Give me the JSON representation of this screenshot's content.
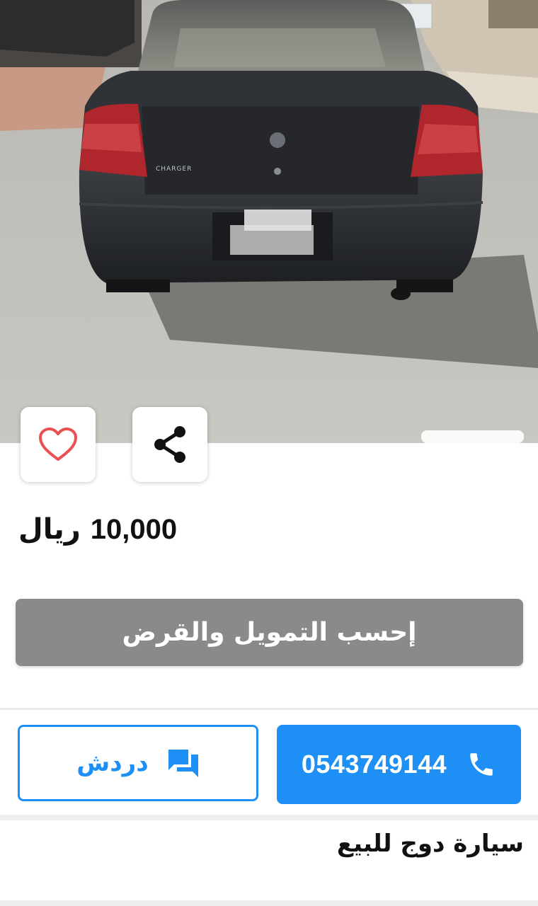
{
  "listing": {
    "price_amount": "10,000",
    "price_currency": "ريال",
    "title": "سيارة دوج للبيع",
    "car_badge": "CHARGER"
  },
  "actions": {
    "finance_label": "إحسب التمويل والقرض",
    "chat_label": "دردش",
    "phone_number": "0543749144"
  },
  "icons": {
    "favorite": "heart-icon",
    "share": "share-icon",
    "chat": "chat-icon",
    "phone": "phone-icon"
  },
  "colors": {
    "accent": "#1e90f5",
    "heart": "#ea4f53",
    "finance_button": "#8a8a8a"
  }
}
